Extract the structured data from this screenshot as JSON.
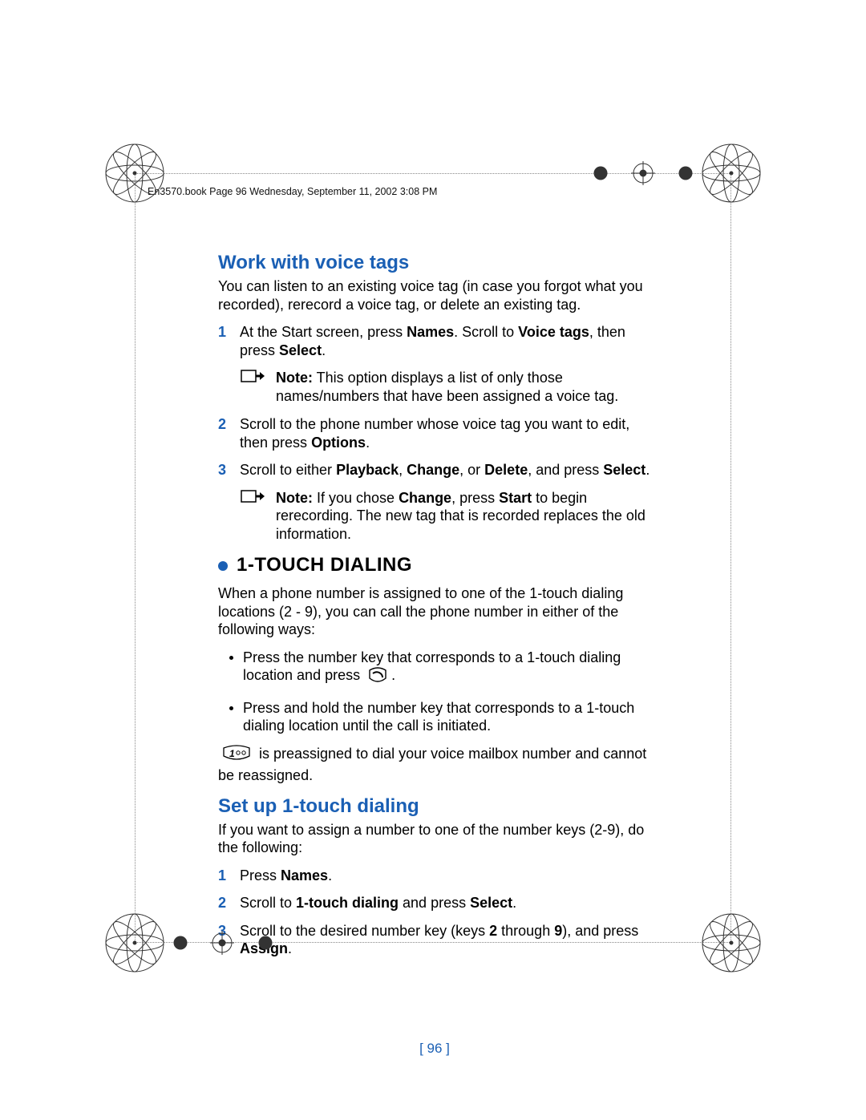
{
  "header": "En3570.book  Page 96  Wednesday, September 11, 2002  3:08 PM",
  "section1": {
    "title": "Work with voice tags",
    "intro": "You can listen to an existing voice tag (in case you forgot what you recorded), rerecord a voice tag, or delete an existing tag.",
    "step1_pre": "At the Start screen, press ",
    "step1_b1": "Names",
    "step1_mid": ". Scroll to ",
    "step1_b2": "Voice tags",
    "step1_after": ", then press ",
    "step1_b3": "Select",
    "step1_end": ".",
    "note1_label": "Note:",
    "note1_text": "  This option displays a list of only those names/numbers that have been assigned a voice tag.",
    "step2_pre": "Scroll to the phone number whose voice tag you want to edit, then press ",
    "step2_b1": "Options",
    "step2_end": ".",
    "step3_pre": "Scroll to either ",
    "step3_b1": "Playback",
    "step3_c1": ", ",
    "step3_b2": "Change",
    "step3_c2": ", or ",
    "step3_b3": "Delete",
    "step3_c3": ", and press ",
    "step3_b4": "Select",
    "step3_end": ".",
    "note2_label": "Note:",
    "note2_pre": " If you chose ",
    "note2_b1": "Change",
    "note2_mid": ", press ",
    "note2_b2": "Start",
    "note2_after": " to begin rerecording. The new tag that is recorded replaces the old information."
  },
  "section2": {
    "title": "1-TOUCH DIALING",
    "intro": "When a phone number is assigned to one of the 1-touch dialing locations (2 - 9), you can call the phone number in either of the following ways:",
    "bullet1_pre": "Press the number key that corresponds to a 1-touch dialing location and press ",
    "bullet1_end": ".",
    "bullet2": "Press and hold the number key that corresponds to a 1-touch dialing location until the call is initiated.",
    "para2": " is preassigned to dial your voice mailbox number and cannot be reassigned."
  },
  "section3": {
    "title": "Set up 1-touch dialing",
    "intro": "If you want to assign a number to one of the number keys (2-9), do the following:",
    "step1_pre": "Press ",
    "step1_b1": "Names",
    "step1_end": ".",
    "step2_pre": "Scroll to ",
    "step2_b1": "1-touch dialing",
    "step2_mid": " and press ",
    "step2_b2": "Select",
    "step2_end": ".",
    "step3_pre": "Scroll to the desired number key (keys ",
    "step3_b1": "2",
    "step3_mid": " through ",
    "step3_b2": "9",
    "step3_after": "), and press ",
    "step3_b3": "Assign",
    "step3_end": "."
  },
  "page_number": "[ 96 ]",
  "nums": {
    "n1": "1",
    "n2": "2",
    "n3": "3"
  }
}
